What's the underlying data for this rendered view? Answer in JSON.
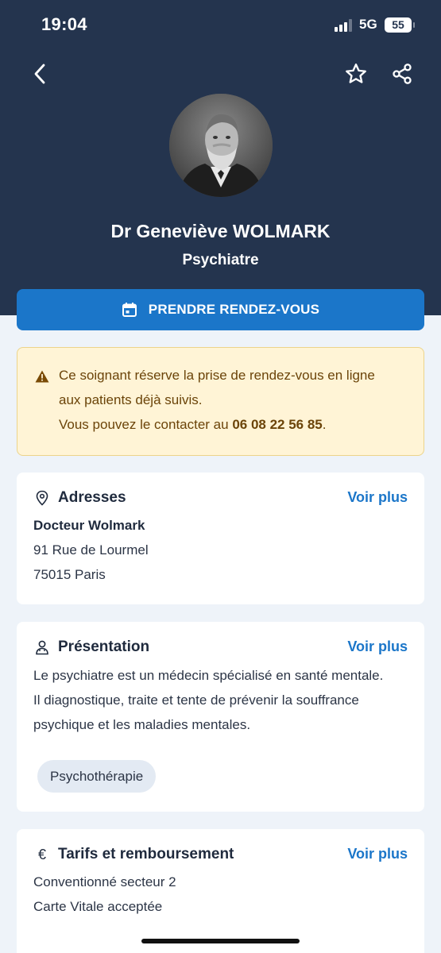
{
  "status_bar": {
    "time": "19:04",
    "network": "5G",
    "battery": "55"
  },
  "doctor": {
    "name": "Dr Geneviève WOLMARK",
    "specialty": "Psychiatre"
  },
  "cta": {
    "label": "PRENDRE RENDEZ-VOUS"
  },
  "warning": {
    "line1": "Ce soignant réserve la prise de rendez-vous en ligne",
    "line2": "aux patients déjà suivis.",
    "line3_prefix": "Vous pouvez le contacter au ",
    "phone": "06 08 22 56 85",
    "line3_suffix": "."
  },
  "addresses": {
    "title": "Adresses",
    "more": "Voir plus",
    "name": "Docteur Wolmark",
    "street": "91 Rue de Lourmel",
    "city": "75015 Paris"
  },
  "presentation": {
    "title": "Présentation",
    "more": "Voir plus",
    "line1": "Le psychiatre est un médecin spécialisé en santé mentale.",
    "line2": "Il diagnostique, traite et tente de prévenir la souffrance",
    "line3": "psychique et les maladies mentales.",
    "tag": "Psychothérapie"
  },
  "tarifs": {
    "icon": "€",
    "title": "Tarifs et remboursement",
    "more": "Voir plus",
    "line1": "Conventionné secteur 2",
    "line2": "Carte Vitale acceptée"
  },
  "colors": {
    "header": "#24344e",
    "accent": "#1b76c9",
    "warning_bg": "#fff4d6",
    "page_bg": "#eef3f9"
  }
}
